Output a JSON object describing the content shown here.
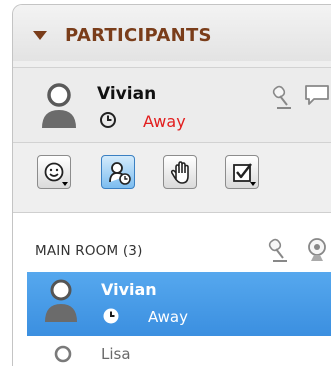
{
  "panel": {
    "title": "PARTICIPANTS",
    "collapse_icon": "triangle-down-icon",
    "accent_color": "#7a3d1a"
  },
  "me": {
    "name": "Vivian",
    "status": "Away",
    "status_color": "#e21d1d",
    "icons": [
      "user-avatar-icon",
      "clock-icon",
      "microphone-icon",
      "chat-bubble-icon"
    ]
  },
  "toolbar": {
    "buttons": [
      {
        "icon": "emoticon-icon",
        "has_dropdown": true,
        "active": false
      },
      {
        "icon": "away-status-icon",
        "has_dropdown": false,
        "active": true
      },
      {
        "icon": "raise-hand-icon",
        "has_dropdown": false,
        "active": false
      },
      {
        "icon": "checkbox-poll-icon",
        "has_dropdown": true,
        "active": false
      }
    ]
  },
  "room": {
    "label": "MAIN ROOM (3)",
    "header_icons": [
      "microphone-icon",
      "webcam-icon"
    ],
    "selection_color": "#3b8fe0",
    "participants": [
      {
        "name": "Vivian",
        "status": "Away",
        "selected": true
      },
      {
        "name": "Lisa",
        "status": "",
        "selected": false
      }
    ]
  }
}
